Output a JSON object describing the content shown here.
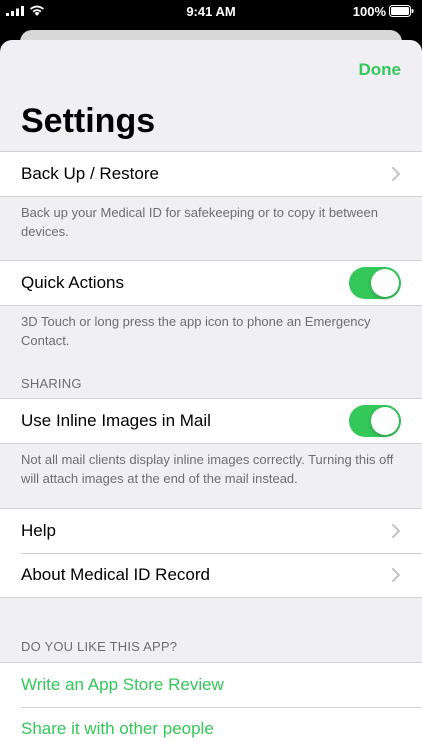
{
  "status_bar": {
    "time": "9:41 AM",
    "battery": "100%"
  },
  "nav": {
    "done_label": "Done",
    "title": "Settings"
  },
  "backup": {
    "label": "Back Up / Restore",
    "footer": "Back up your Medical ID for safekeeping or to copy it between devices."
  },
  "quick_actions": {
    "label": "Quick Actions",
    "enabled": true,
    "footer": "3D Touch or long press the app icon to phone an Emergency Contact."
  },
  "sharing": {
    "header": "SHARING",
    "inline_images_label": "Use Inline Images in Mail",
    "enabled": true,
    "footer": "Not all mail clients display inline images correctly. Turning this off will attach images at the end of the mail instead."
  },
  "info": {
    "help_label": "Help",
    "about_label": "About Medical ID Record"
  },
  "like": {
    "header": "DO YOU LIKE THIS APP?",
    "review_label": "Write an App Store Review",
    "share_label": "Share it with other people"
  },
  "colors": {
    "accent": "#34c759",
    "background": "#efeff4",
    "secondary_text": "#6d6d72"
  }
}
